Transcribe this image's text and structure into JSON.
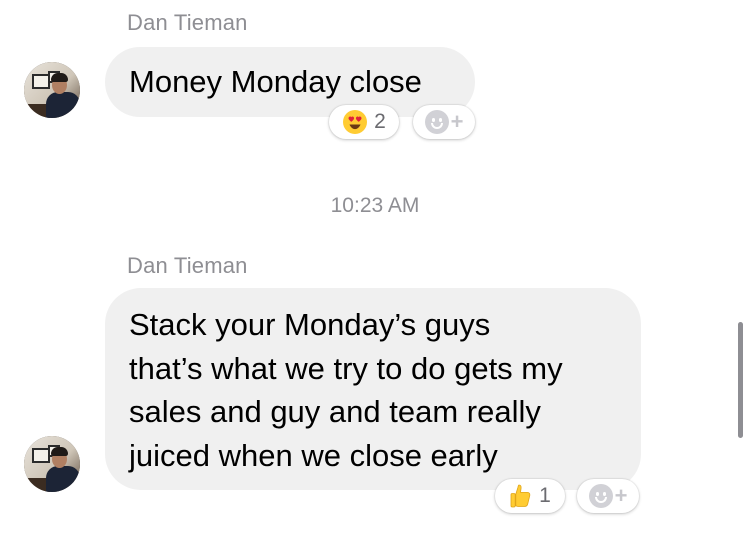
{
  "messages": [
    {
      "sender": "Dan Tieman",
      "lines": [
        "Money Monday close"
      ],
      "reaction": {
        "icon": "heart-eyes-emoji",
        "count": "2"
      }
    },
    {
      "sender": "Dan Tieman",
      "lines": [
        "Stack your Monday’s guys",
        "that’s what we try to do gets my",
        "sales and guy and team really",
        "juiced when we close early"
      ],
      "reaction": {
        "icon": "thumbs-up-emoji",
        "count": "1"
      }
    }
  ],
  "timestamp": "10:23 AM",
  "colors": {
    "bubble": "#f0f0f0",
    "meta_text": "#8e8e93",
    "emoji_yellow": "#ffcc33",
    "heart_red": "#e0243a"
  }
}
